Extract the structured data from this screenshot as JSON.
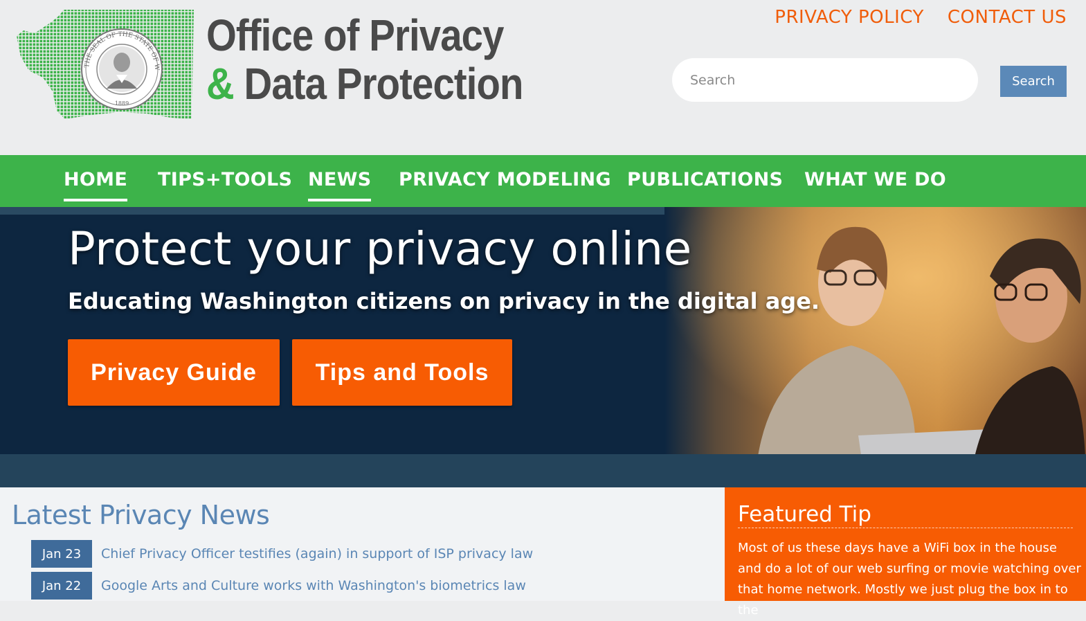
{
  "header": {
    "brand_line1": "Office of Privacy",
    "brand_amp": "&",
    "brand_line2": "Data Protection",
    "seal_text": "THE SEAL OF THE STATE OF WASHINGTON 1889",
    "top_links": [
      "PRIVACY POLICY",
      "CONTACT US"
    ],
    "search_placeholder": "Search",
    "search_button": "Search"
  },
  "nav": {
    "items": [
      {
        "label": "HOME",
        "active": true
      },
      {
        "label": "TIPS+TOOLS",
        "active": false
      },
      {
        "label": "NEWS",
        "active": true
      },
      {
        "label": "PRIVACY MODELING",
        "active": false
      },
      {
        "label": "PUBLICATIONS",
        "active": false
      },
      {
        "label": "WHAT WE DO",
        "active": false
      }
    ]
  },
  "hero": {
    "title": "Protect your privacy online",
    "subtitle": "Educating Washington citizens on privacy in the digital age.",
    "buttons": [
      "Privacy Guide",
      "Tips and Tools"
    ]
  },
  "news": {
    "title": "Latest Privacy News",
    "items": [
      {
        "date": "Jan 23",
        "text": "Chief Privacy Officer testifies (again) in support of ISP privacy law"
      },
      {
        "date": "Jan 22",
        "text": "Google Arts and Culture works with Washington's biometrics law"
      }
    ]
  },
  "featured_tip": {
    "title": "Featured Tip",
    "text": "Most of us these days have a WiFi box in the house and do a lot of our web surfing or movie watching over that home network.  Mostly we just plug the box in to the"
  },
  "colors": {
    "green": "#3db34a",
    "orange": "#f75c03",
    "link_blue": "#5a86b4",
    "navy": "#0d2640"
  }
}
